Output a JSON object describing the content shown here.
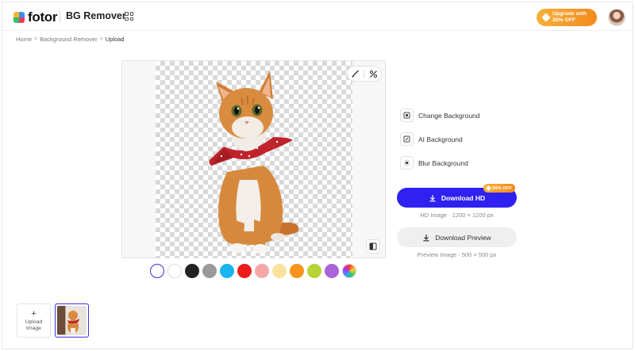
{
  "header": {
    "logo_text": "fotor",
    "product_name": "BG Remover",
    "upgrade_label_1": "Upgrade with",
    "upgrade_label_2": "20% OFF",
    "accent_orange": "#f39a24",
    "apps_icon": "grid-apps-icon",
    "avatar_icon": "user-avatar"
  },
  "breadcrumb": {
    "items": [
      "Home",
      "Background Remover",
      "Upload"
    ]
  },
  "canvas": {
    "tools": [
      "brush-icon",
      "erase-restore-icon"
    ],
    "compare_icon": "compare-icon"
  },
  "swatches": {
    "colors": [
      "transparent",
      "#ffffff",
      "#222222",
      "#9a9a9a",
      "#1ab4ee",
      "#ee1b1b",
      "#f4a7a7",
      "#f9e39a",
      "#f7941d",
      "#b7d334",
      "#a864d8",
      "rainbow"
    ],
    "selected": "transparent"
  },
  "options": {
    "change_bg": "Change Background",
    "ai_bg": "AI Background",
    "blur_bg": "Blur Background"
  },
  "download": {
    "hd_label": "Download HD",
    "hd_badge": "20% OFF",
    "hd_info": "HD Image · 1200 × 1200 px",
    "preview_label": "Download Preview",
    "preview_info": "Preview Image · 500 × 500 px",
    "primary_color": "#2f21f0"
  },
  "bottom": {
    "upload_label_1": "Upload",
    "upload_label_2": "Image"
  }
}
